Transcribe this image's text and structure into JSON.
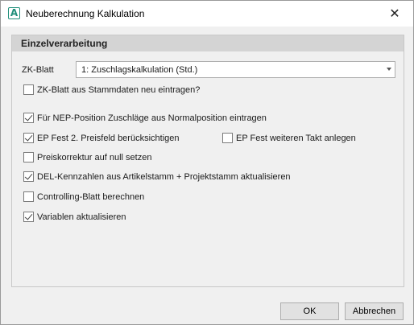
{
  "window": {
    "title": "Neuberechnung Kalkulation",
    "app_icon_letter": "A",
    "close_glyph": "✕",
    "accent_color": "#1f8f7a"
  },
  "group": {
    "header": "Einzelverarbeitung"
  },
  "zk_blatt": {
    "label": "ZK-Blatt",
    "selected": "1: Zuschlagskalkulation (Std.)"
  },
  "checkboxes": [
    {
      "label": "ZK-Blatt aus Stammdaten neu eintragen?",
      "checked": false
    },
    {
      "label": "Für NEP-Position Zuschläge aus Normalposition eintragen",
      "checked": true
    },
    {
      "label": "EP Fest 2. Preisfeld berücksichtigen",
      "checked": true
    },
    {
      "label": "EP Fest weiteren Takt anlegen",
      "checked": false
    },
    {
      "label": "Preiskorrektur auf null setzen",
      "checked": false
    },
    {
      "label": "DEL-Kennzahlen aus Artikelstamm + Projektstamm aktualisieren",
      "checked": true
    },
    {
      "label": "Controlling-Blatt berechnen",
      "checked": false
    },
    {
      "label": "Variablen aktualisieren",
      "checked": true
    }
  ],
  "buttons": {
    "ok": "OK",
    "cancel": "Abbrechen"
  }
}
